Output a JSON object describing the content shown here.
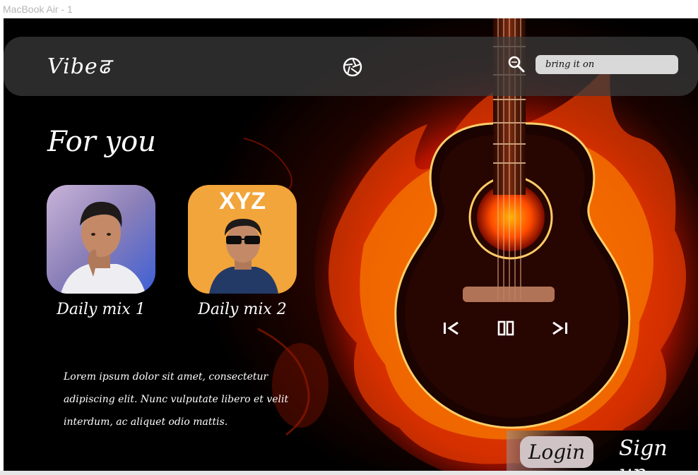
{
  "frame": {
    "label": "MacBook Air - 1"
  },
  "nav": {
    "logo": "Vibeढ",
    "center_icon": "camera-shutter-icon",
    "search_icon": "search-icon",
    "search_placeholder": "bring it on"
  },
  "main": {
    "section_title": "For you",
    "cards": [
      {
        "label": "Daily mix 1",
        "image": "portrait of young man"
      },
      {
        "label": "Daily mix 2",
        "image": "album cover",
        "cover_text": "XYZ"
      }
    ],
    "description": "Lorem ipsum dolor sit amet, consectetur adipiscing elit. Nunc vulputate libero et velit interdum, ac aliquet odio mattis."
  },
  "player": {
    "prev_icon": "skip-previous-icon",
    "pause_icon": "pause-icon",
    "next_icon": "skip-next-icon"
  },
  "auth": {
    "login_label": "Login",
    "signup_label": "Sign up"
  },
  "colors": {
    "background": "#000000",
    "nav_bg": "#3c3c3c",
    "search_bg": "#d9d9d9",
    "login_bg": "#cfc3c6",
    "flame_orange": "#ff6a00",
    "flame_red": "#c41400",
    "card2_bg": "#f2a53a",
    "text": "#ffffff"
  }
}
